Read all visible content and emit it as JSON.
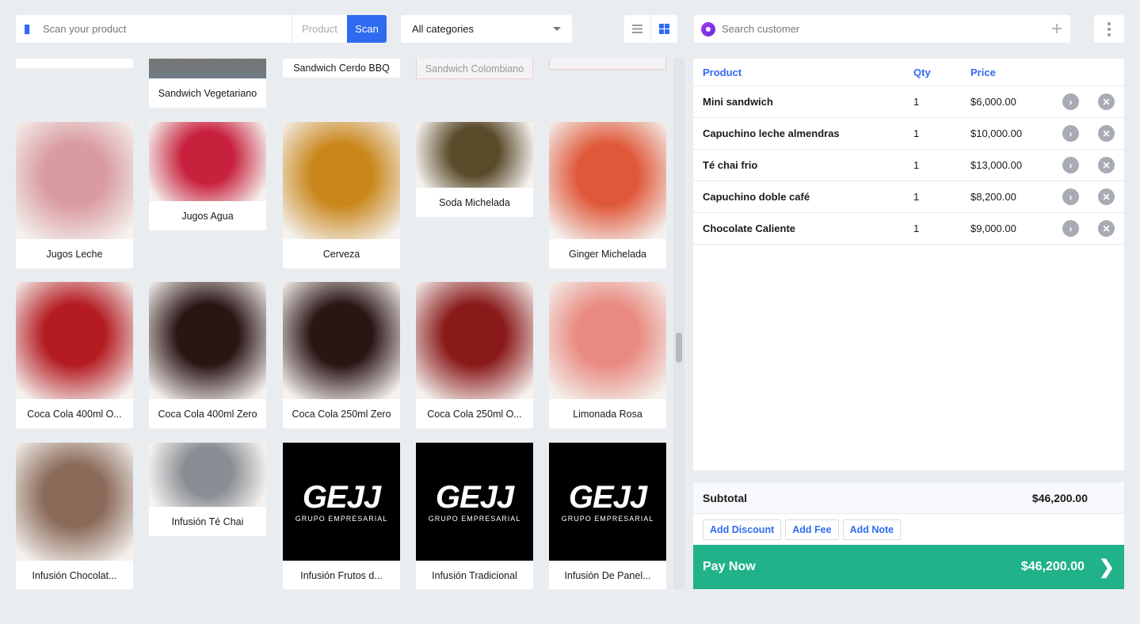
{
  "toolbar": {
    "scan_placeholder": "Scan your product",
    "product_mode": "Product",
    "scan_label": "Scan",
    "category": "All categories",
    "list_view_icon": "list-icon",
    "grid_view_icon": "grid-icon",
    "accent": "#2f6bf0"
  },
  "customer": {
    "placeholder": "Search customer",
    "add_icon": "plus-icon",
    "more_icon": "kebab-icon"
  },
  "products": [
    {
      "name": "",
      "color": "#ffffff"
    },
    {
      "name": "Sandwich Vegetariano",
      "color": "#8a6a48"
    },
    {
      "name": "Sandwich Cerdo BBQ",
      "color": "#ffffff"
    },
    {
      "name": "Sandwich Colombiano",
      "color": "#f3f3f5",
      "disabled": true
    },
    {
      "name": "",
      "color": "#f3f3f5",
      "disabled": true
    },
    {
      "name": "Jugos Leche",
      "color": "#d99ba0"
    },
    {
      "name": "Jugos Agua",
      "color": "#c8213d"
    },
    {
      "name": "Cerveza",
      "color": "#c9861a"
    },
    {
      "name": "Soda Michelada",
      "color": "#5a4a2a"
    },
    {
      "name": "Ginger Michelada",
      "color": "#e0583a"
    },
    {
      "name": "Coca Cola 400ml O...",
      "color": "#b41c22"
    },
    {
      "name": "Coca Cola 400ml Zero",
      "color": "#2a1414"
    },
    {
      "name": "Coca Cola 250ml Zero",
      "color": "#2a1414"
    },
    {
      "name": "Coca Cola 250ml O...",
      "color": "#8a1a1a"
    },
    {
      "name": "Limonada Rosa",
      "color": "#e98a80"
    },
    {
      "name": "Infusión Chocolat...",
      "color": "#8a6a58"
    },
    {
      "name": "Infusión Té Chai",
      "color": "#8a8e94"
    },
    {
      "name": "Infusión Frutos d...",
      "logo": true
    },
    {
      "name": "Infusión Tradicional",
      "logo": true
    },
    {
      "name": "Infusión De Panel...",
      "logo": true
    }
  ],
  "logo": {
    "mark": "GEJJ",
    "sub": "GRUPO EMPRESARIAL"
  },
  "cart": {
    "headers": {
      "product": "Product",
      "qty": "Qty",
      "price": "Price"
    },
    "items": [
      {
        "product": "Mini sandwich",
        "qty": "1",
        "price": "$6,000.00"
      },
      {
        "product": "Capuchino leche almendras",
        "qty": "1",
        "price": "$10,000.00"
      },
      {
        "product": "Té chai frio",
        "qty": "1",
        "price": "$13,000.00"
      },
      {
        "product": "Capuchino doble café",
        "qty": "1",
        "price": "$8,200.00"
      },
      {
        "product": "Chocolate Caliente",
        "qty": "1",
        "price": "$9,000.00"
      }
    ]
  },
  "summary": {
    "subtotal_label": "Subtotal",
    "subtotal": "$46,200.00",
    "add_discount": "Add Discount",
    "add_fee": "Add Fee",
    "add_note": "Add Note",
    "pay_label": "Pay Now",
    "pay_total": "$46,200.00",
    "pay_color": "#21b28a"
  }
}
